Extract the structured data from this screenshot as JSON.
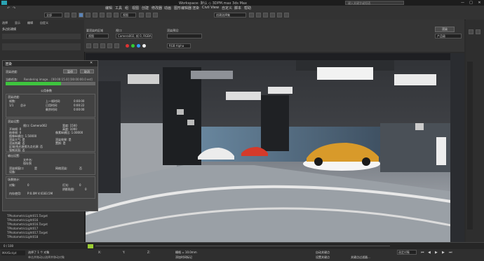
{
  "titlebar": {
    "title": "Workspace: 默认  ◇ 3DPM.max  3ds Max",
    "search_placeholder": "键入关键字或短语",
    "min": "—",
    "max": "□",
    "close": "✕"
  },
  "menu": [
    "编辑",
    "工具",
    "组",
    "视图",
    "创建",
    "修改器",
    "动画",
    "图形编辑器",
    "渲染",
    "Civil View",
    "自定义",
    "脚本",
    "帮助"
  ],
  "toolbar": {
    "undo_label": "全部",
    "selection_set": "创建选择集",
    "view_dropdown": "视图"
  },
  "render_setup": {
    "target_label": "渲染帧窗口",
    "area_label": "要渲染的区域",
    "area_value": "视图",
    "viewport_label": "视口:",
    "viewport_value": "Camera002, 帧 0, RGBA Color 16 Bits/Channel (1:1)",
    "preset_label": "渲染预设:",
    "preset_value": "",
    "output_label": "输出",
    "render_button": "渲染",
    "renderer_label": "产品级",
    "channel_value": "RGB Alpha"
  },
  "viewport": {
    "label": "[Camera002, 帧 0, RGBA 颜色 16 位/通道 (1:1)]"
  },
  "left_panel": {
    "tabs": [
      "选择",
      "显示",
      "编辑",
      "自定义"
    ],
    "section_title": "多边形建模",
    "tree_items": [
      "TPhotometricLight015.Target",
      "TPhotometricLight016",
      "TPhotometricLight016.Target",
      "TPhotometricLight017",
      "TPhotometricLight017.Target",
      "TPhotometricLight018",
      "TPhotometricLight018.Target"
    ]
  },
  "render_dialog": {
    "title": "渲染",
    "pause_button": "暂停",
    "cancel_button": "取消",
    "status_header": "渲染进度:",
    "current_task_label": "当前任务:",
    "current_task_value": "Rendering image... [00:00:15.0] [00:00:00.0 est]",
    "progress": 0.62,
    "common_params_title": "公用参数",
    "render_progress_label": "渲染进度:",
    "frame_label": "帧数:",
    "frame_value": "1/1",
    "total_label": "总计",
    "last_frame_time_label": "上一帧时间:",
    "last_frame_time_value": "0:00:00",
    "elapsed_label": "已用时间:",
    "elapsed_value": "0:00:22",
    "remaining_label": "剩余时间:",
    "remaining_value": "0:00:00",
    "scene_info_title": "渲染设置:",
    "viewport_info": "视口: Camera002",
    "width_info": "宽度: 1500",
    "height_info": "高度: 1000",
    "pixel_aspect_info": "像素纵横比: 1.00000",
    "start_frame": "开始帧: 0",
    "end_frame": "结束帧: 0",
    "image_aspect": "图像纵横比: 1.50000",
    "apply_atmos": "渲染大气: 是",
    "render_hidden": "渲染隐藏: 否",
    "displacement": "置换: 是",
    "render_effects": "渲染效果: 是",
    "area_lights": "区域/线光源视为点光源: 否",
    "force_2sided": "强制双面: 否",
    "output_title": "输出设置:",
    "file_label": "文件名:",
    "file_value": "保存到",
    "device_label": "设备:",
    "vfb_label": "渲染帧窗口:",
    "vfb_value": "是",
    "net_render_label": "网络渲染:",
    "net_render_value": "否",
    "scene_stats_title": "场景统计:",
    "objects_label": "对象:",
    "objects_value": "0",
    "lights_label": "灯光:",
    "lights_value": "0",
    "shadows_label": "阴影贴图:",
    "shadows_value": "0",
    "mem_label": "内存使用:",
    "mem_value": "P:0.0M  V:4183.5M"
  },
  "status": {
    "selection": "选择了 1 个 对象",
    "prompt": "单击并拖动以选择并移动对象",
    "frame": "0 / 100",
    "auto_key": "自动关键点",
    "set_key": "设置关键点",
    "selected": "选定对象",
    "filters": "关键点过滤器...",
    "grid": "栅格 = 10.0mm",
    "add_time_tag": "添加时间标记",
    "x_label": "X:",
    "y_label": "Y:",
    "z_label": "Z:"
  }
}
